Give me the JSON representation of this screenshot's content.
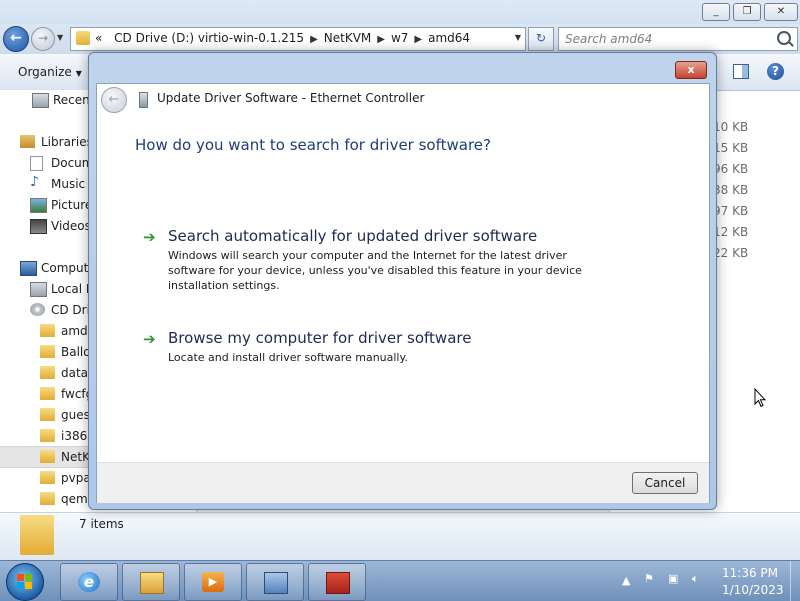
{
  "explorer": {
    "address": {
      "overflow": "«",
      "crumbs": [
        "CD Drive (D:) virtio-win-0.1.215",
        "NetKVM",
        "w7",
        "amd64"
      ]
    },
    "search_placeholder": "Search amd64",
    "toolbar": {
      "organize_label": "Organize"
    },
    "nav": {
      "recent": "Recent",
      "libraries": "Libraries",
      "documents": "Docum",
      "music": "Music",
      "pictures": "Picture",
      "videos": "Videos",
      "computer": "Compute",
      "local_disk": "Local D",
      "cd_drive": "CD Driv",
      "folders": [
        "amd6",
        "Ballo",
        "data",
        "fwcfg",
        "guest",
        "i386",
        "NetK",
        "pvpa",
        "qemu"
      ]
    },
    "file_sizes": [
      "10 KB",
      "15 KB",
      "96 KB",
      "38 KB",
      "97 KB",
      "12 KB",
      "22 KB"
    ],
    "status": {
      "item_count": "7 items"
    }
  },
  "dialog": {
    "title": "Update Driver Software - Ethernet Controller",
    "question": "How do you want to search for driver software?",
    "options": [
      {
        "title": "Search automatically for updated driver software",
        "description": "Windows will search your computer and the Internet for the latest driver software for your device, unless you've disabled this feature in your device installation settings."
      },
      {
        "title": "Browse my computer for driver software",
        "description": "Locate and install driver software manually."
      }
    ],
    "cancel_label": "Cancel",
    "close_label": "x"
  },
  "taskbar": {
    "apps": [
      "internet-explorer",
      "windows-explorer",
      "media-player",
      "device-manager",
      "toolbox"
    ],
    "clock": {
      "time": "11:36 PM",
      "date": "1/10/2023"
    }
  },
  "icons": {
    "back": "back-arrow-icon",
    "forward": "forward-arrow-icon",
    "option_arrow": "green-arrow-icon"
  },
  "colors": {
    "question_text": "#1f3d7a",
    "option_arrow": "#2b9a2b",
    "close_button": "#c7432e",
    "taskbar": "#6f91bb"
  }
}
